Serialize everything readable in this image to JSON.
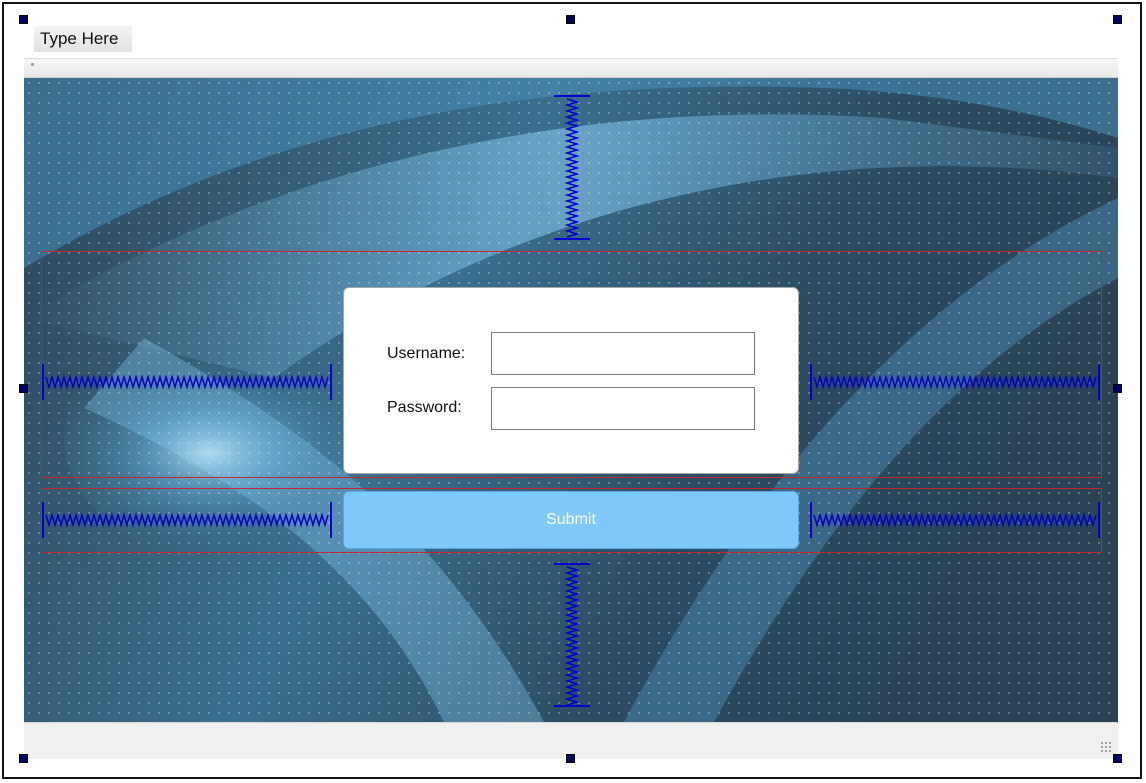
{
  "menubar": {
    "type_here_label": "Type Here"
  },
  "login_form": {
    "username_label": "Username:",
    "password_label": "Password:",
    "username_value": "",
    "password_value": ""
  },
  "submit_button": {
    "label": "Submit"
  },
  "colors": {
    "background": "#2e4a5e",
    "submit_button": "#7ec8fa",
    "layout_box": "#c1272d",
    "spacer": "#0000cc",
    "selection_handle": "#000066"
  }
}
